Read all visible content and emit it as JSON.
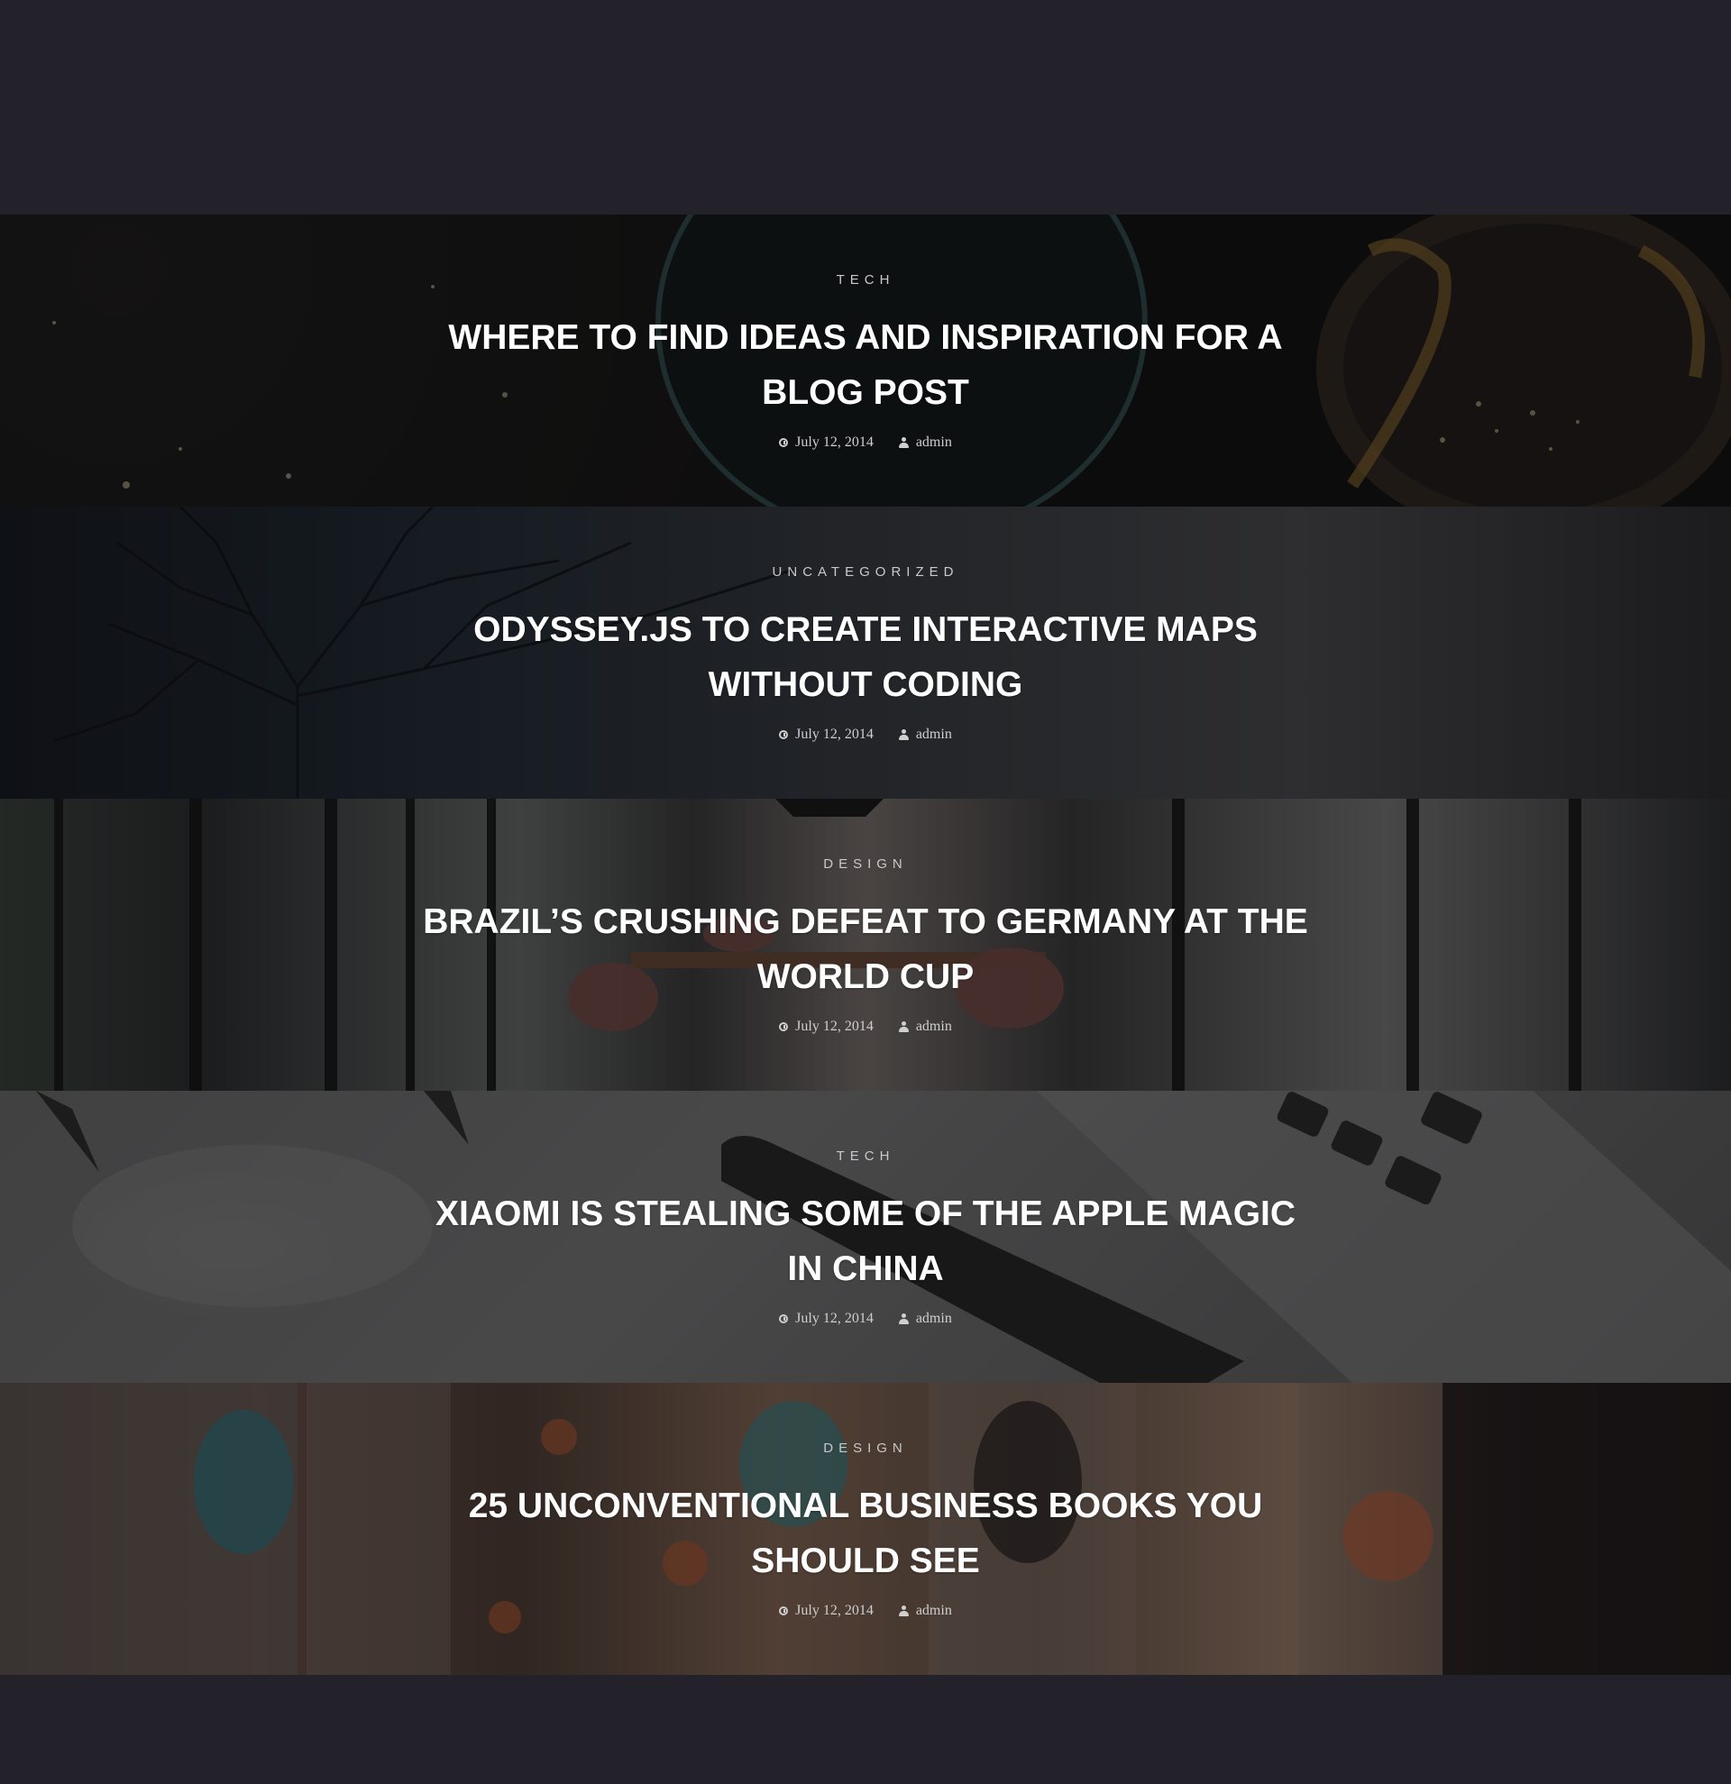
{
  "posts": [
    {
      "category": "TECH",
      "title": "WHERE TO FIND IDEAS AND INSPIRATION FOR A BLOG POST",
      "date": "July 12, 2014",
      "author": "admin"
    },
    {
      "category": "UNCATEGORIZED",
      "title": "ODYSSEY.JS TO CREATE INTERACTIVE MAPS WITHOUT CODING",
      "date": "July 12, 2014",
      "author": "admin"
    },
    {
      "category": "DESIGN",
      "title": "BRAZIL’S CRUSHING DEFEAT TO GERMANY AT THE WORLD CUP",
      "date": "July 12, 2014",
      "author": "admin"
    },
    {
      "category": "TECH",
      "title": "XIAOMI IS STEALING SOME OF THE APPLE MAGIC IN CHINA",
      "date": "July 12, 2014",
      "author": "admin"
    },
    {
      "category": "DESIGN",
      "title": "25 UNCONVENTIONAL BUSINESS BOOKS YOU SHOULD SEE",
      "date": "July 12, 2014",
      "author": "admin"
    }
  ],
  "colors": {
    "page_background": "#23222a",
    "title": "#ffffff",
    "meta": "#cfcfcf"
  }
}
